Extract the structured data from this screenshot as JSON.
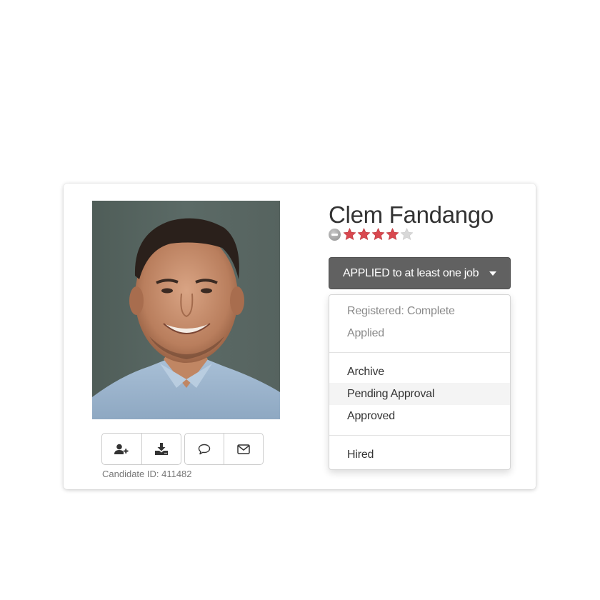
{
  "candidate": {
    "name": "Clem Fandango",
    "rating": {
      "value": 4,
      "max": 5,
      "clear_icon": "minus-circle-icon"
    },
    "candidate_id_label": "Candidate ID: 411482",
    "photo_alt": "Candidate photo"
  },
  "actions": [
    {
      "name": "add-user-button",
      "icon": "user-plus-icon"
    },
    {
      "name": "download-button",
      "icon": "download-icon"
    },
    {
      "name": "comment-button",
      "icon": "speech-bubble-icon"
    },
    {
      "name": "email-button",
      "icon": "envelope-icon"
    }
  ],
  "status": {
    "button_label": "APPLIED to at least one job",
    "caret_icon": "caret-down-icon",
    "menu": {
      "info_items": [
        "Registered: Complete",
        "Applied"
      ],
      "action_items": [
        "Archive",
        "Pending Approval",
        "Approved"
      ],
      "final_items": [
        "Hired"
      ],
      "highlighted": "Pending Approval"
    }
  },
  "colors": {
    "status_button_bg": "#616161",
    "star_filled": "#d9484f",
    "star_empty": "#d8d8d8",
    "menu_highlight": "#f4f4f4"
  }
}
